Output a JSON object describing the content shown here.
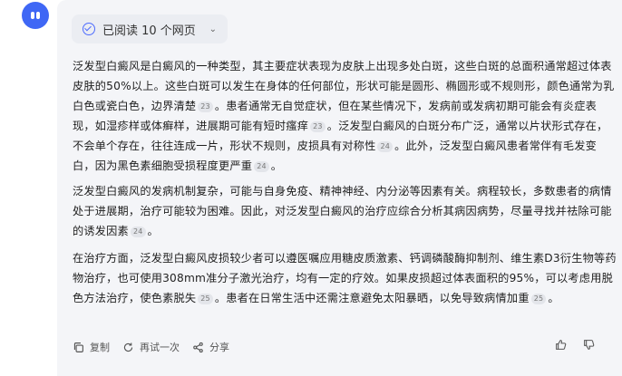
{
  "header": {
    "reads_label": "已阅读 10 个网页"
  },
  "paragraphs": [
    {
      "segments": [
        {
          "text": "泛发型白癜风是白癜风的一种类型，其主要症状表现为皮肤上出现多处白斑，这些白斑的总面积通常超过体表皮肤的50%以上。这些白斑可以发生在身体的任何部位，形状可能是圆形、椭圆形或不规则形，颜色通常为乳白色或瓷白色，边界清楚"
        },
        {
          "cite": "23"
        },
        {
          "text": "。患者通常无自觉症状，但在某些情况下，发病前或发病初期可能会有炎症表现，如湿疹样或体癣样，进展期可能有短时瘙痒"
        },
        {
          "cite": "23"
        },
        {
          "text": "。泛发型白癜风的白斑分布广泛，通常以片状形式存在，不会单个存在，往往连成一片，形状不规则，皮损具有对称性"
        },
        {
          "cite": "24"
        },
        {
          "text": "。此外，泛发型白癜风患者常伴有毛发变白，因为黑色素细胞受损程度更严重"
        },
        {
          "cite": "24"
        },
        {
          "text": "。"
        }
      ]
    },
    {
      "segments": [
        {
          "text": "泛发型白癜风的发病机制复杂，可能与自身免疫、精神神经、内分泌等因素有关。病程较长，多数患者的病情处于进展期，治疗可能较为困难。因此，对泛发型白癜风的治疗应综合分析其病因病势，尽量寻找并祛除可能的诱发因素"
        },
        {
          "cite": "24"
        },
        {
          "text": "。"
        }
      ]
    },
    {
      "segments": [
        {
          "text": "在治疗方面，泛发型白癜风皮损较少者可以遵医嘱应用糖皮质激素、钙调磷酸酶抑制剂、维生素D3衍生物等药物治疗，也可使用308mm准分子激光治疗，均有一定的疗效。如果皮损超过体表面积的95%，可以考虑用脱色方法治疗，使色素脱失"
        },
        {
          "cite": "25"
        },
        {
          "text": "。患者在日常生活中还需注意避免太阳暴晒，以免导致病情加重"
        },
        {
          "cite": "25"
        },
        {
          "text": "。"
        }
      ]
    }
  ],
  "actions": {
    "copy_label": "复制",
    "retry_label": "再试一次",
    "share_label": "分享"
  }
}
